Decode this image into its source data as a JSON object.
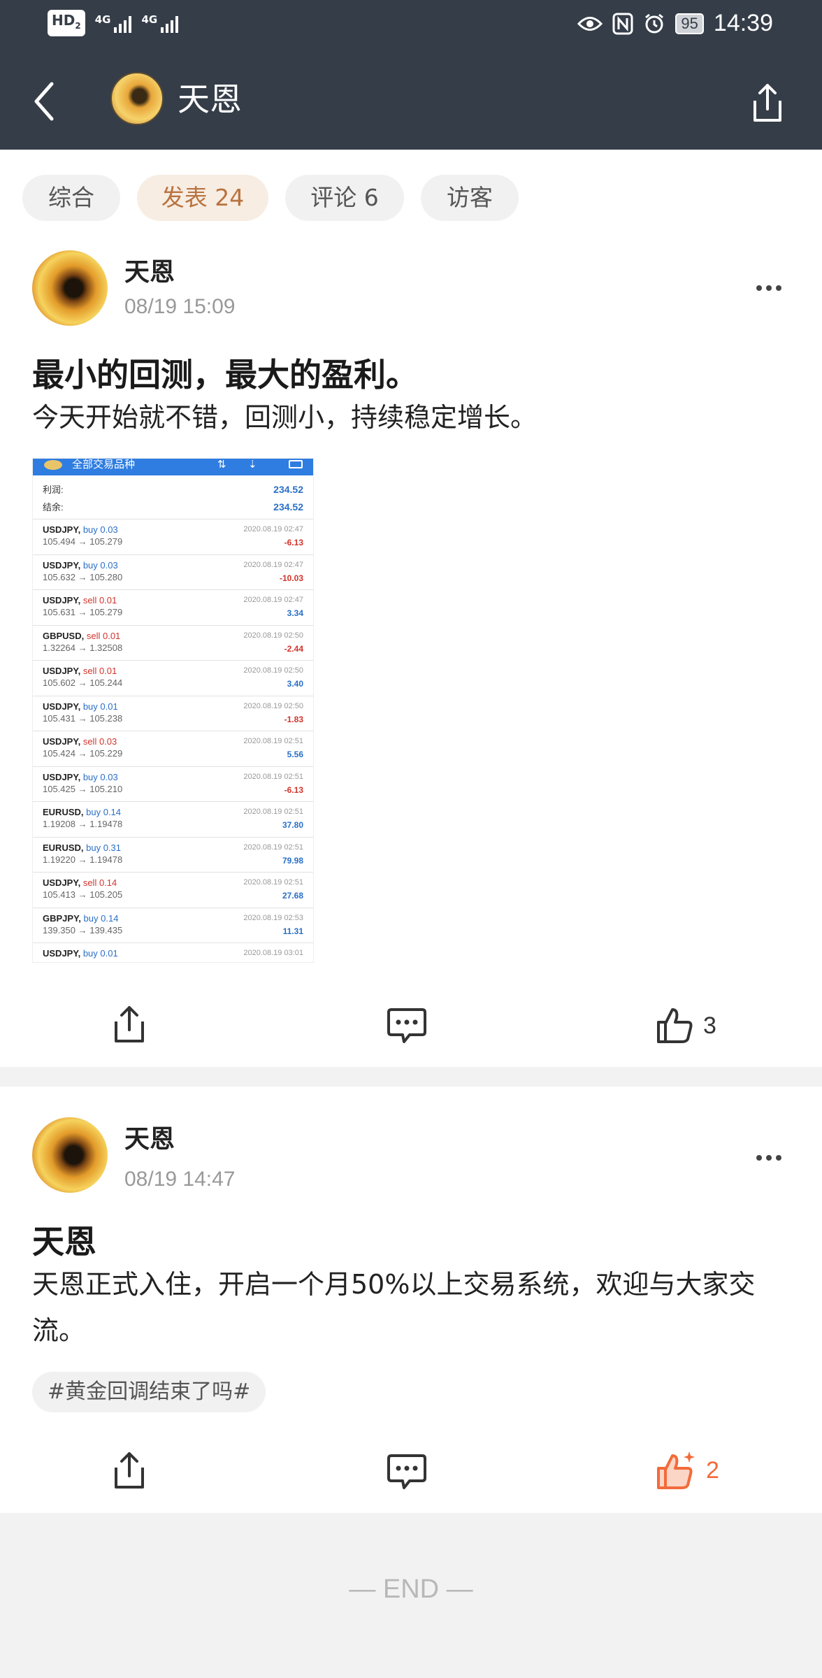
{
  "status": {
    "hd": "HD",
    "hd_sub": "2",
    "net1": "4G",
    "net2": "4G",
    "battery": "95",
    "time": "14:39"
  },
  "nav": {
    "title": "天恩"
  },
  "tabs": [
    {
      "label": "综合"
    },
    {
      "label": "发表 24"
    },
    {
      "label": "评论 6"
    },
    {
      "label": "访客"
    }
  ],
  "posts": [
    {
      "author": "天恩",
      "time": "08/19 15:09",
      "title": "最小的回测，最大的盈利。",
      "text": "今天开始就不错，回测小，持续稳定增长。",
      "likes": "3",
      "image": {
        "header": "全部交易品种",
        "summary": [
          {
            "label": "利润:",
            "value": "234.52"
          },
          {
            "label": "结余:",
            "value": "234.52"
          }
        ],
        "trades": [
          {
            "symbol": "USDJPY,",
            "side": "buy 0.03",
            "prices": "105.494 → 105.279",
            "date": "2020.08.19 02:47",
            "pl": "-6.13"
          },
          {
            "symbol": "USDJPY,",
            "side": "buy 0.03",
            "prices": "105.632 → 105.280",
            "date": "2020.08.19 02:47",
            "pl": "-10.03"
          },
          {
            "symbol": "USDJPY,",
            "side": "sell 0.01",
            "prices": "105.631 → 105.279",
            "date": "2020.08.19 02:47",
            "pl": "3.34"
          },
          {
            "symbol": "GBPUSD,",
            "side": "sell 0.01",
            "prices": "1.32264 → 1.32508",
            "date": "2020.08.19 02:50",
            "pl": "-2.44"
          },
          {
            "symbol": "USDJPY,",
            "side": "sell 0.01",
            "prices": "105.602 → 105.244",
            "date": "2020.08.19 02:50",
            "pl": "3.40"
          },
          {
            "symbol": "USDJPY,",
            "side": "buy 0.01",
            "prices": "105.431 → 105.238",
            "date": "2020.08.19 02:50",
            "pl": "-1.83"
          },
          {
            "symbol": "USDJPY,",
            "side": "sell 0.03",
            "prices": "105.424 → 105.229",
            "date": "2020.08.19 02:51",
            "pl": "5.56"
          },
          {
            "symbol": "USDJPY,",
            "side": "buy 0.03",
            "prices": "105.425 → 105.210",
            "date": "2020.08.19 02:51",
            "pl": "-6.13"
          },
          {
            "symbol": "EURUSD,",
            "side": "buy 0.14",
            "prices": "1.19208 → 1.19478",
            "date": "2020.08.19 02:51",
            "pl": "37.80"
          },
          {
            "symbol": "EURUSD,",
            "side": "buy 0.31",
            "prices": "1.19220 → 1.19478",
            "date": "2020.08.19 02:51",
            "pl": "79.98"
          },
          {
            "symbol": "USDJPY,",
            "side": "sell 0.14",
            "prices": "105.413 → 105.205",
            "date": "2020.08.19 02:51",
            "pl": "27.68"
          },
          {
            "symbol": "GBPJPY,",
            "side": "buy 0.14",
            "prices": "139.350 → 139.435",
            "date": "2020.08.19 02:53",
            "pl": "11.31"
          },
          {
            "symbol": "USDJPY,",
            "side": "buy 0.01",
            "prices": "",
            "date": "2020.08.19 03:01",
            "pl": ""
          }
        ]
      }
    },
    {
      "author": "天恩",
      "time": "08/19 14:47",
      "title": "天恩",
      "text": "天恩正式入住，开启一个月50%以上交易系统，欢迎与大家交流。",
      "tag": "#黄金回调结束了吗#",
      "likes": "2"
    }
  ],
  "end_label": "— END —",
  "colors": {
    "header_bg": "#353d48",
    "accent": "#b9733f",
    "liked": "#f26b3a",
    "profit": "#2a6fc6",
    "loss": "#d0342c"
  }
}
